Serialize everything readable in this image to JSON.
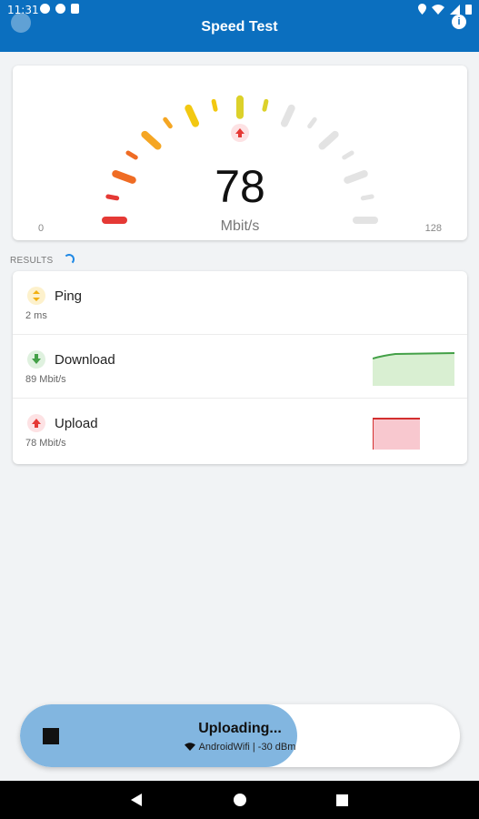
{
  "status_bar": {
    "time": "11:31"
  },
  "app_bar": {
    "title": "Speed Test",
    "info_glyph": "i"
  },
  "gauge": {
    "value": "78",
    "unit": "Mbit/s",
    "min_label": "0",
    "max_label": "128",
    "current_fraction": 0.61,
    "active_colors": [
      "#e53935",
      "#ef6c24",
      "#f5a623",
      "#f2c811",
      "#dcd12a"
    ],
    "inactive_color": "#e3e3e3",
    "arrow_color": "#e53935"
  },
  "results": {
    "header": "RESULTS",
    "items": [
      {
        "name": "Ping",
        "value": "2 ms",
        "icon": "swap-vert-icon",
        "icon_color": "#fbc02d",
        "icon_bg": "#fdf1cc"
      },
      {
        "name": "Download",
        "value": "89 Mbit/s",
        "icon": "download-arrow-icon",
        "icon_color": "#43a047",
        "icon_bg": "#dff1df",
        "graph_color": "#43a047",
        "graph_fill": "#d9efd2"
      },
      {
        "name": "Upload",
        "value": "78 Mbit/s",
        "icon": "upload-arrow-icon",
        "icon_color": "#e53935",
        "icon_bg": "#fde2e4",
        "graph_color": "#d32f2f",
        "graph_fill": "#f8c8cf"
      }
    ]
  },
  "bottom": {
    "status": "Uploading...",
    "network": "AndroidWifi | -30 dBm",
    "progress": 0.63,
    "stop_icon": "stop-icon"
  },
  "nav": {
    "back_icon": "back-icon",
    "home_icon": "home-icon",
    "recents_icon": "recents-icon"
  }
}
